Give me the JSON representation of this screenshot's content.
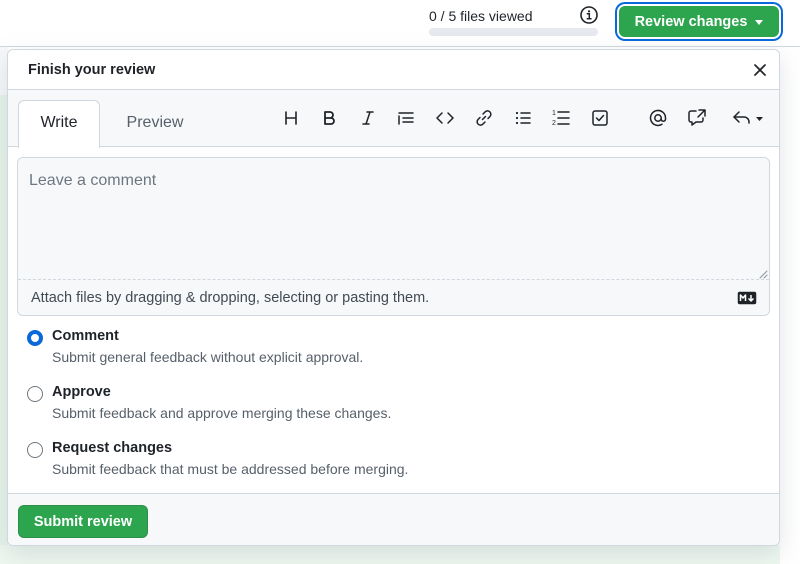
{
  "header": {
    "files_viewed": "0 / 5 files viewed",
    "files_viewed_progress": 0,
    "review_button_label": "Review changes"
  },
  "dialog": {
    "title": "Finish your review",
    "tabs": [
      {
        "label": "Write",
        "active": true
      },
      {
        "label": "Preview",
        "active": false
      }
    ],
    "toolbar": [
      {
        "icon": "heading-icon",
        "tooltip": "Heading"
      },
      {
        "icon": "bold-icon",
        "tooltip": "Bold"
      },
      {
        "icon": "italic-icon",
        "tooltip": "Italic"
      },
      {
        "icon": "quote-icon",
        "tooltip": "Quote"
      },
      {
        "icon": "code-icon",
        "tooltip": "Code"
      },
      {
        "icon": "link-icon",
        "tooltip": "Link"
      },
      {
        "icon": "unordered-list-icon",
        "tooltip": "Unordered list"
      },
      {
        "icon": "ordered-list-icon",
        "tooltip": "Numbered list"
      },
      {
        "icon": "task-list-icon",
        "tooltip": "Task list"
      },
      {
        "icon": "mention-icon",
        "tooltip": "Mention"
      },
      {
        "icon": "cross-reference-icon",
        "tooltip": "Reference"
      },
      {
        "icon": "reply-icon",
        "tooltip": "Saved replies"
      }
    ],
    "comment": {
      "value": "",
      "placeholder": "Leave a comment"
    },
    "attach_text": "Attach files by dragging & dropping, selecting or pasting them.",
    "options": [
      {
        "label": "Comment",
        "description": "Submit general feedback without explicit approval.",
        "checked": true
      },
      {
        "label": "Approve",
        "description": "Submit feedback and approve merging these changes.",
        "checked": false
      },
      {
        "label": "Request changes",
        "description": "Submit feedback that must be addressed before merging.",
        "checked": false
      }
    ],
    "submit_label": "Submit review"
  },
  "colors": {
    "primary_green": "#2da44e",
    "accent_blue": "#0969da",
    "border": "#d0d7de",
    "muted_text": "#57606a"
  }
}
